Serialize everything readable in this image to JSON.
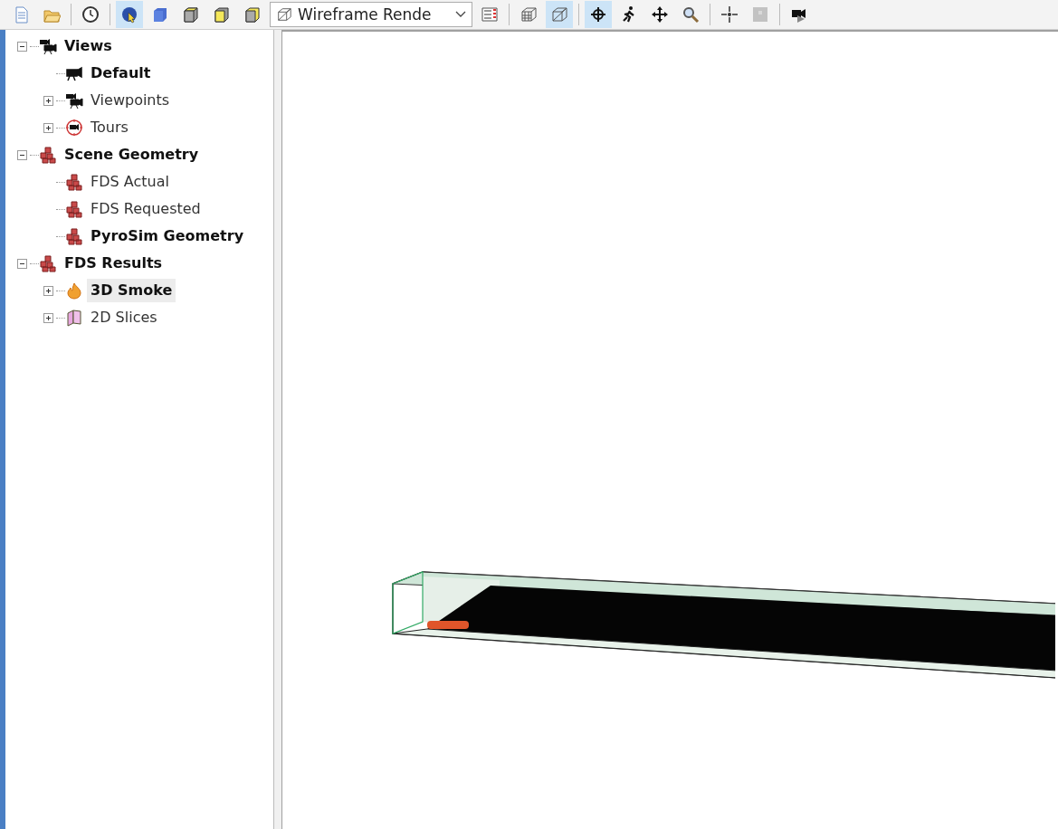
{
  "toolbar": [
    {
      "kind": "new-document",
      "selected": false,
      "disabled": false
    },
    {
      "kind": "open-folder",
      "selected": false,
      "disabled": false
    },
    {
      "kind": "separator"
    },
    {
      "kind": "clock",
      "selected": false,
      "disabled": false
    },
    {
      "kind": "separator"
    },
    {
      "kind": "select-pointer",
      "selected": true,
      "disabled": false
    },
    {
      "kind": "solid-cube",
      "selected": false,
      "disabled": false
    },
    {
      "kind": "box-top",
      "selected": false,
      "disabled": false
    },
    {
      "kind": "box-front",
      "selected": false,
      "disabled": false
    },
    {
      "kind": "box-side",
      "selected": false,
      "disabled": false
    },
    {
      "kind": "dropdown",
      "value": "Wireframe Rende"
    },
    {
      "kind": "list-numbers",
      "selected": false,
      "disabled": false
    },
    {
      "kind": "separator"
    },
    {
      "kind": "grid-box",
      "selected": false,
      "disabled": false
    },
    {
      "kind": "wire-box",
      "selected": true,
      "disabled": false
    },
    {
      "kind": "separator"
    },
    {
      "kind": "orbit",
      "selected": true,
      "disabled": false
    },
    {
      "kind": "walk",
      "selected": false,
      "disabled": false
    },
    {
      "kind": "pan",
      "selected": false,
      "disabled": false
    },
    {
      "kind": "zoom",
      "selected": false,
      "disabled": false
    },
    {
      "kind": "separator"
    },
    {
      "kind": "center",
      "selected": false,
      "disabled": false
    },
    {
      "kind": "puzzle",
      "selected": false,
      "disabled": true
    },
    {
      "kind": "separator"
    },
    {
      "kind": "camera-play",
      "selected": false,
      "disabled": false
    }
  ],
  "tree": [
    {
      "label": "Views",
      "kind": "camera-group",
      "bold": true,
      "selected": false,
      "expanded": true,
      "children": [
        {
          "label": "Default",
          "kind": "camera",
          "bold": true,
          "selected": false
        },
        {
          "label": "Viewpoints",
          "kind": "camera-group",
          "bold": false,
          "selected": false,
          "expanded": false
        },
        {
          "label": "Tours",
          "kind": "tour",
          "bold": false,
          "selected": false,
          "expanded": false
        }
      ]
    },
    {
      "label": "Scene Geometry",
      "kind": "geometry",
      "bold": true,
      "selected": false,
      "expanded": true,
      "children": [
        {
          "label": "FDS Actual",
          "kind": "geometry",
          "bold": false,
          "selected": false
        },
        {
          "label": "FDS Requested",
          "kind": "geometry",
          "bold": false,
          "selected": false
        },
        {
          "label": "PyroSim Geometry",
          "kind": "geometry",
          "bold": true,
          "selected": false
        }
      ]
    },
    {
      "label": "FDS Results",
      "kind": "geometry",
      "bold": true,
      "selected": false,
      "expanded": true,
      "children": [
        {
          "label": "3D Smoke",
          "kind": "smoke",
          "bold": true,
          "selected": true,
          "expanded": false
        },
        {
          "label": "2D Slices",
          "kind": "slices",
          "bold": false,
          "selected": false,
          "expanded": false
        }
      ]
    }
  ]
}
